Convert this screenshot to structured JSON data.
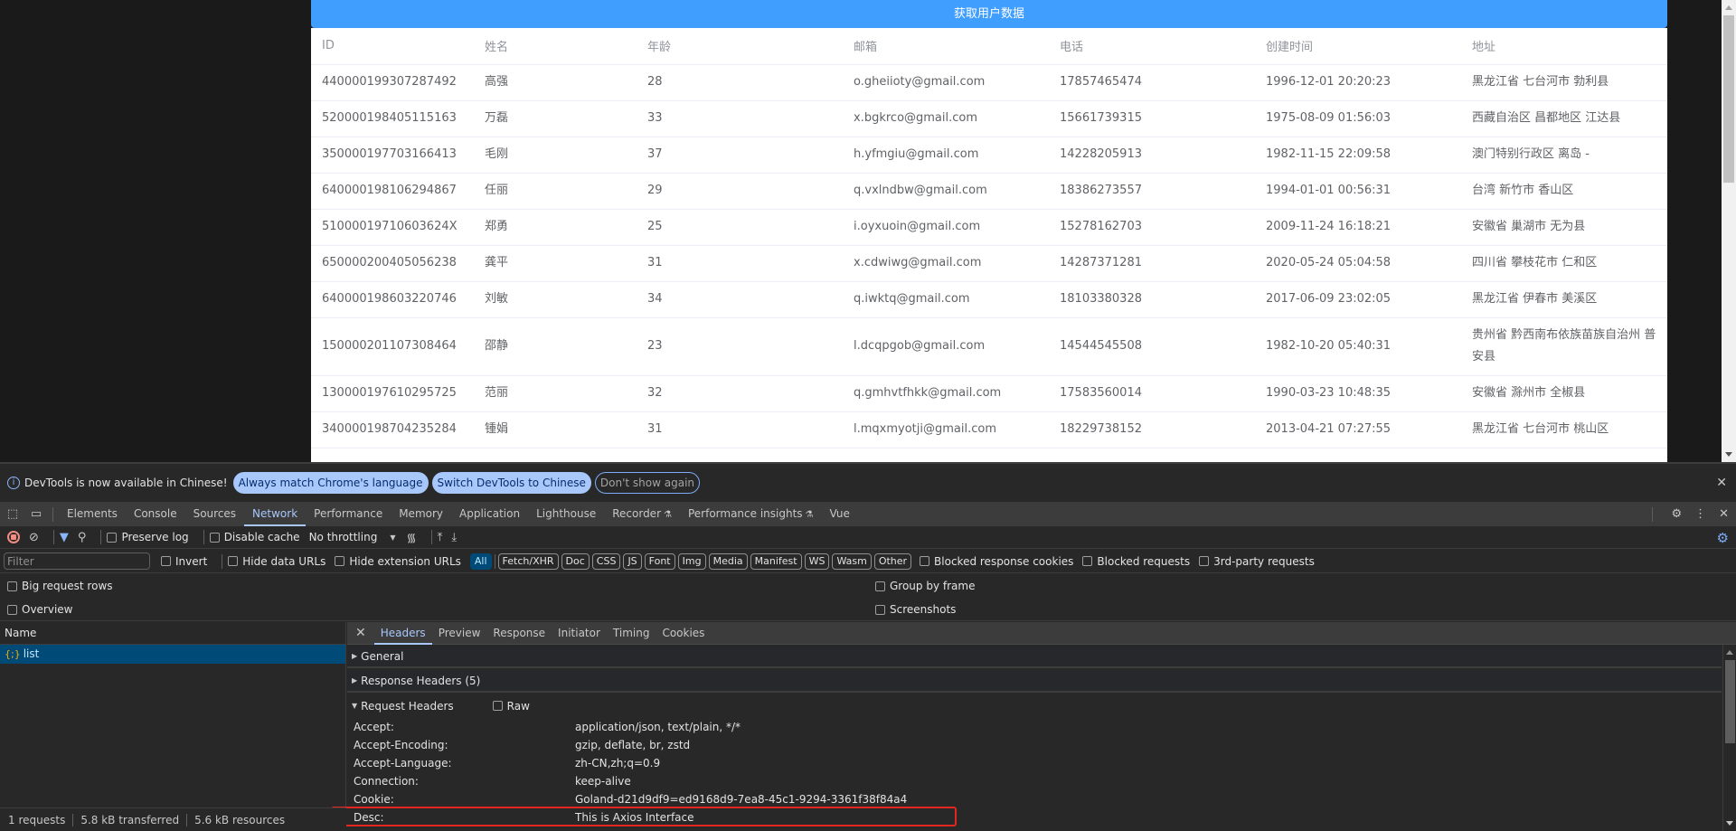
{
  "page": {
    "fetch_button": "获取用户数据",
    "columns": [
      "ID",
      "姓名",
      "年龄",
      "邮箱",
      "电话",
      "创建时间",
      "地址"
    ],
    "rows": [
      {
        "id": "440000199307287492",
        "name": "高强",
        "age": "28",
        "email": "o.gheiioty@gmail.com",
        "phone": "17857465474",
        "created": "1996-12-01 20:20:23",
        "address": "黑龙江省 七台河市 勃利县"
      },
      {
        "id": "520000198405115163",
        "name": "万磊",
        "age": "33",
        "email": "x.bgkrco@gmail.com",
        "phone": "15661739315",
        "created": "1975-08-09 01:56:03",
        "address": "西藏自治区 昌都地区 江达县"
      },
      {
        "id": "350000197703166413",
        "name": "毛刚",
        "age": "37",
        "email": "h.yfmgiu@gmail.com",
        "phone": "14228205913",
        "created": "1982-11-15 22:09:58",
        "address": "澳门特别行政区 离岛 -"
      },
      {
        "id": "640000198106294867",
        "name": "任丽",
        "age": "29",
        "email": "q.vxlndbw@gmail.com",
        "phone": "18386273557",
        "created": "1994-01-01 00:56:31",
        "address": "台湾 新竹市 香山区"
      },
      {
        "id": "51000019710603624X",
        "name": "郑勇",
        "age": "25",
        "email": "i.oyxuoin@gmail.com",
        "phone": "15278162703",
        "created": "2009-11-24 16:18:21",
        "address": "安徽省 巢湖市 无为县"
      },
      {
        "id": "650000200405056238",
        "name": "龚平",
        "age": "31",
        "email": "x.cdwiwg@gmail.com",
        "phone": "14287371281",
        "created": "2020-05-24 05:04:58",
        "address": "四川省 攀枝花市 仁和区"
      },
      {
        "id": "640000198603220746",
        "name": "刘敏",
        "age": "34",
        "email": "q.iwktq@gmail.com",
        "phone": "18103380328",
        "created": "2017-06-09 23:02:05",
        "address": "黑龙江省 伊春市 美溪区"
      },
      {
        "id": "150000201107308464",
        "name": "邵静",
        "age": "23",
        "email": "l.dcqpgob@gmail.com",
        "phone": "14544545508",
        "created": "1982-10-20 05:40:31",
        "address": "贵州省 黔西南布依族苗族自治州 普安县"
      },
      {
        "id": "130000197610295725",
        "name": "范丽",
        "age": "32",
        "email": "q.gmhvtfhkk@gmail.com",
        "phone": "17583560014",
        "created": "1990-03-23 10:48:35",
        "address": "安徽省 滁州市 全椒县"
      },
      {
        "id": "340000198704235284",
        "name": "锺娟",
        "age": "31",
        "email": "l.mqxmyotji@gmail.com",
        "phone": "18229738152",
        "created": "2013-04-21 07:27:55",
        "address": "黑龙江省 七台河市 桃山区"
      }
    ]
  },
  "devtools": {
    "infobar": {
      "message": "DevTools is now available in Chinese!",
      "btn_match": "Always match Chrome's language",
      "btn_switch": "Switch DevTools to Chinese",
      "btn_dismiss": "Don't show again"
    },
    "tabs": [
      "Elements",
      "Console",
      "Sources",
      "Network",
      "Performance",
      "Memory",
      "Application",
      "Lighthouse",
      "Recorder",
      "Performance insights",
      "Vue"
    ],
    "active_tab": "Network",
    "toolbar": {
      "preserve_log": "Preserve log",
      "disable_cache": "Disable cache",
      "throttling": "No throttling"
    },
    "filter": {
      "placeholder": "Filter",
      "invert": "Invert",
      "hide_data_urls": "Hide data URLs",
      "hide_extension_urls": "Hide extension URLs",
      "types": [
        "All",
        "Fetch/XHR",
        "Doc",
        "CSS",
        "JS",
        "Font",
        "Img",
        "Media",
        "Manifest",
        "WS",
        "Wasm",
        "Other"
      ],
      "active_type": "All",
      "blocked_cookies": "Blocked response cookies",
      "blocked_requests": "Blocked requests",
      "third_party": "3rd-party requests"
    },
    "options": {
      "big_rows": "Big request rows",
      "overview": "Overview",
      "group_by_frame": "Group by frame",
      "screenshots": "Screenshots"
    },
    "name_column": "Name",
    "requests": [
      {
        "name": "list",
        "type_icon": "xhr-icon"
      }
    ],
    "detail_tabs": [
      "Headers",
      "Preview",
      "Response",
      "Initiator",
      "Timing",
      "Cookies"
    ],
    "active_detail_tab": "Headers",
    "sections": {
      "general": "General",
      "response_headers": "Response Headers (5)",
      "request_headers": "Request Headers",
      "raw": "Raw"
    },
    "request_headers": [
      {
        "name": "Accept:",
        "value": "application/json, text/plain, */*"
      },
      {
        "name": "Accept-Encoding:",
        "value": "gzip, deflate, br, zstd"
      },
      {
        "name": "Accept-Language:",
        "value": "zh-CN,zh;q=0.9"
      },
      {
        "name": "Connection:",
        "value": "keep-alive"
      },
      {
        "name": "Cookie:",
        "value": "Goland-d21d9df9=ed9168d9-7ea8-45c1-9294-3361f38f84a4"
      },
      {
        "name": "Desc:",
        "value": "This is Axios Interface"
      }
    ],
    "highlighted_header": "Desc:",
    "status": {
      "requests": "1 requests",
      "transferred": "5.8 kB transferred",
      "resources": "5.6 kB resources"
    }
  }
}
